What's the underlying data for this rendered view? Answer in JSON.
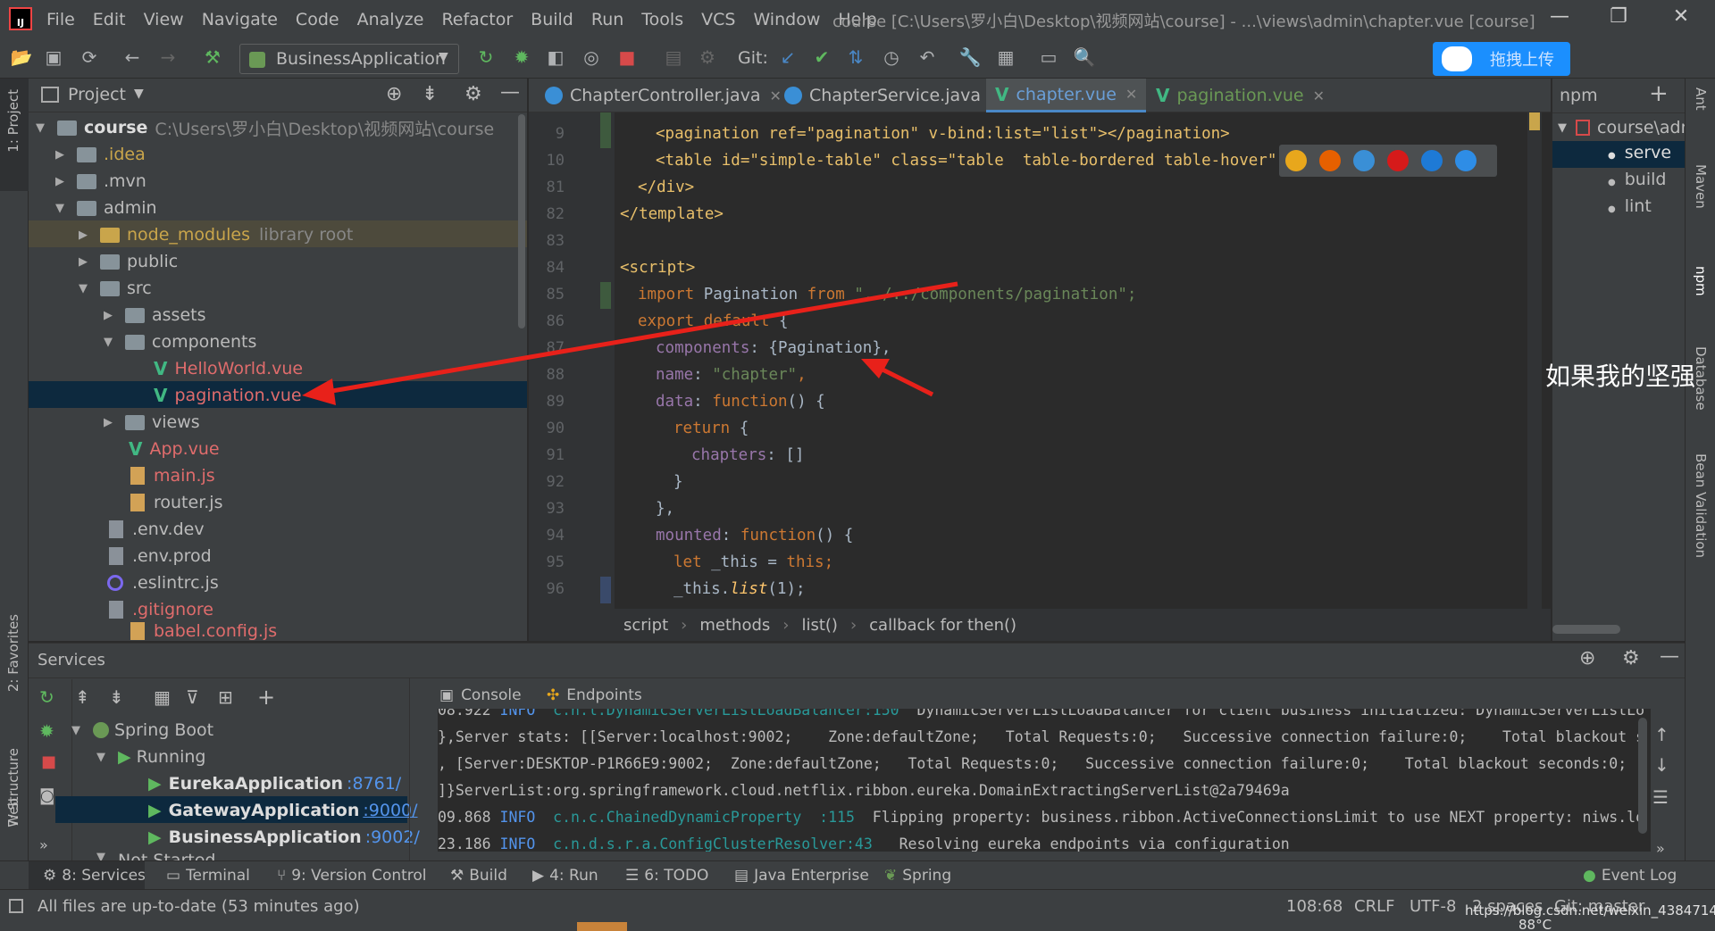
{
  "menu": {
    "items": [
      "File",
      "Edit",
      "View",
      "Navigate",
      "Code",
      "Analyze",
      "Refactor",
      "Build",
      "Run",
      "Tools",
      "VCS",
      "Window",
      "Help"
    ],
    "window_title": "course [C:\\Users\\罗小白\\Desktop\\视频网站\\course] - ...\\views\\admin\\chapter.vue [course]"
  },
  "toolbar": {
    "run_config": "BusinessApplication",
    "git_label": "Git:",
    "upload_label": "拖拽上传"
  },
  "left_strip": {
    "project_tab": "1: Project",
    "favorites_tab": "2: Favorites",
    "structure_tab": "7: Structure",
    "web_tab": "Web"
  },
  "project": {
    "title": "Project",
    "root_name": "course",
    "root_path": "C:\\Users\\罗小白\\Desktop\\视频网站\\course",
    "items": [
      {
        "label": "course"
      },
      {
        "label": ".idea"
      },
      {
        "label": ".mvn"
      },
      {
        "label": "admin"
      },
      {
        "label": "node_modules",
        "suffix": "library root"
      },
      {
        "label": "public"
      },
      {
        "label": "src"
      },
      {
        "label": "assets"
      },
      {
        "label": "components"
      },
      {
        "label": "HelloWorld.vue"
      },
      {
        "label": "pagination.vue"
      },
      {
        "label": "views"
      },
      {
        "label": "App.vue"
      },
      {
        "label": "main.js"
      },
      {
        "label": "router.js"
      },
      {
        "label": ".env.dev"
      },
      {
        "label": ".env.prod"
      },
      {
        "label": ".eslintrc.js"
      },
      {
        "label": ".gitignore"
      },
      {
        "label": "babel.config.js"
      }
    ]
  },
  "editor": {
    "tabs": [
      {
        "label": "ChapterController.java"
      },
      {
        "label": "ChapterService.java"
      },
      {
        "label": "chapter.vue"
      },
      {
        "label": "pagination.vue"
      }
    ],
    "line_numbers": [
      "9",
      "10",
      "81",
      "82",
      "83",
      "84",
      "85",
      "86",
      "87",
      "88",
      "89",
      "90",
      "91",
      "92",
      "93",
      "94",
      "95",
      "96"
    ],
    "lines": {
      "l9": "<pagination ref=\"pagination\" v-bind:list=\"list\"></pagination>",
      "l10": "<table id=\"simple-table\" class=\"table  table-bordered table-hover\"...>",
      "l81": "</div>",
      "l82": "</template>",
      "l84": "<script>",
      "l85a": "import",
      "l85b": " Pagination ",
      "l85c": "from",
      "l85d": " \"../../components/pagination\";",
      "l86a": "export default",
      "l86b": " {",
      "l87a": "components",
      "l87b": ": {Pagination},",
      "l88a": "name",
      "l88b": ": ",
      "l88c": "\"chapter\"",
      "l88d": ",",
      "l89a": "data",
      "l89b": ": ",
      "l89c": "function",
      "l89d": "() {",
      "l90a": "return",
      "l90b": " {",
      "l91a": "chapters",
      "l91b": ": []",
      "l92": "}",
      "l93": "},",
      "l94a": "mounted",
      "l94b": ": ",
      "l94c": "function",
      "l94d": "() {",
      "l95a": "let",
      "l95b": " _this = ",
      "l95c": "this",
      "l95d": ";",
      "l96a": "_this.",
      "l96b": "list",
      "l96c": "(1);"
    },
    "breadcrumb": [
      "script",
      "methods",
      "list()",
      "callback for then()"
    ]
  },
  "npm": {
    "title": "npm",
    "root": "course\\adn",
    "scripts": [
      "serve",
      "build",
      "lint"
    ],
    "overlay_text": "如果我的坚强"
  },
  "right_strip": {
    "ant": "Ant",
    "maven": "Maven",
    "npm": "npm",
    "database": "Database",
    "bean": "Bean Validation"
  },
  "services": {
    "title": "Services",
    "tree": {
      "spring_boot": "Spring Boot",
      "running": "Running",
      "apps": [
        {
          "name": "EurekaApplication",
          "port": ":8761/"
        },
        {
          "name": "GatewayApplication",
          "port": ":9000/"
        },
        {
          "name": "BusinessApplication",
          "port": ":9002/"
        }
      ],
      "not_started": "Not Started"
    },
    "tabs": {
      "console": "Console",
      "endpoints": "Endpoints"
    },
    "log": [
      {
        "a": "08.922 ",
        "b": "INFO",
        "c": "  c.n.l.DynamicServerListLoadBalancer:150",
        "d": "  DynamicServerListLoadBalancer for client business initialized: DynamicServerListLo"
      },
      {
        "a": "},Server stats: [[Server:localhost:9002;    Zone:defaultZone;   Total Requests:0;   Successive connection failure:0;    Total blackout s"
      },
      {
        "a": ", [Server:DESKTOP-P1R66E9:9002;  Zone:defaultZone;   Total Requests:0;   Successive connection failure:0;    Total blackout seconds:0;"
      },
      {
        "a": "]}ServerList:org.springframework.cloud.netflix.ribbon.eureka.DomainExtractingServerList@2a79469a"
      },
      {
        "a": "09.868 ",
        "b": "INFO",
        "c": "  c.n.c.ChainedDynamicProperty  :115",
        "d": "  Flipping property: business.ribbon.ActiveConnectionsLimit to use NEXT property: niws.lo"
      },
      {
        "a": "23.186 ",
        "b": "INFO",
        "c": "  c.n.d.s.r.a.ConfigClusterResolver:43",
        "d": "   Resolving eureka endpoints via configuration"
      }
    ]
  },
  "bottom_tabs": [
    "8: Services",
    "Terminal",
    "9: Version Control",
    "Build",
    "4: Run",
    "6: TODO",
    "Java Enterprise",
    "Spring",
    "Event Log"
  ],
  "status": {
    "message": "All files are up-to-date (53 minutes ago)",
    "position": "108:68",
    "line_sep": "CRLF",
    "encoding": "UTF-8",
    "indent": "2 spaces",
    "branch": "Git: master",
    "watermark": "https://blog.csdn.net/weixin_43847148",
    "temp": "88°C"
  },
  "colors": {
    "accent": "#4a88c7",
    "selection": "#0d293e",
    "arrow": "#e8211a"
  }
}
